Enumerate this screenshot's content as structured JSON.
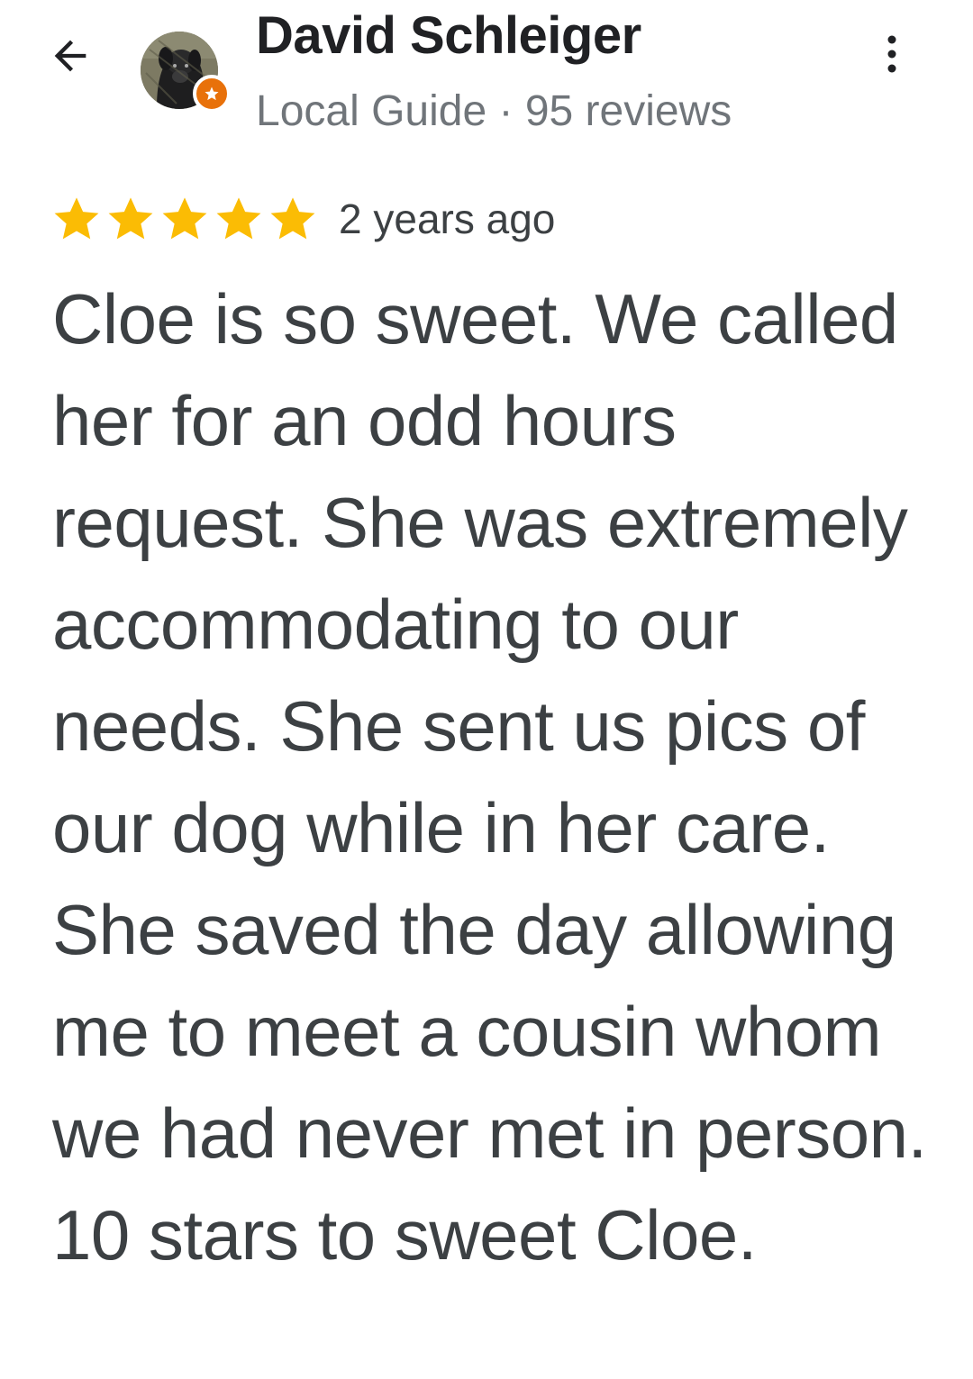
{
  "reviewer": {
    "name": "David Schleiger",
    "subtitle": "Local Guide · 95 reviews",
    "badge": "local-guide-star-badge"
  },
  "icons": {
    "back": "arrow-left-icon",
    "more": "more-vert-icon",
    "star": "star-icon"
  },
  "review": {
    "rating": 5,
    "rating_max": 5,
    "time": "2 years ago",
    "text": "Cloe is so sweet. We called her for an odd hours request. She was extremely accommodating to our needs. She sent us pics of our dog while in her care. She saved the day allowing me to meet a cousin whom we had never met in person.  10 stars to sweet Cloe."
  },
  "colors": {
    "star": "#fbbc04",
    "badge": "#e8710a",
    "name": "#202124",
    "secondary": "#70757a",
    "body": "#3c4043"
  }
}
